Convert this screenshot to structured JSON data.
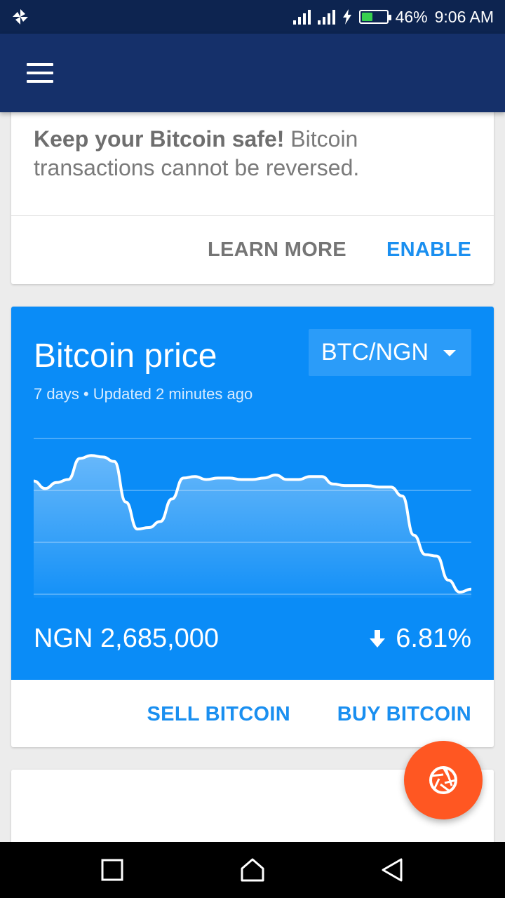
{
  "status_bar": {
    "battery_percent": "46%",
    "time": "9:06 AM",
    "battery_level": 0.46,
    "battery_color": "#37d04f"
  },
  "app_bar": {
    "menu_icon": "hamburger-menu-icon",
    "color": "#15306a"
  },
  "safety_card": {
    "headline": "Keep your Bitcoin safe!",
    "body": " Bitcoin transactions cannot be reversed.",
    "learn_more_label": "LEARN MORE",
    "enable_label": "ENABLE"
  },
  "price_card": {
    "title": "Bitcoin price",
    "pair_selected": "BTC/NGN",
    "subtitle": "7 days • Updated 2 minutes ago",
    "price": "NGN 2,685,000",
    "change": "6.81%",
    "change_direction": "down",
    "sell_label": "SELL BITCOIN",
    "buy_label": "BUY BITCOIN",
    "panel_color": "#0a8cf7",
    "chart_series": [
      0.74,
      0.69,
      0.73,
      0.75,
      0.89,
      0.91,
      0.9,
      0.87,
      0.6,
      0.42,
      0.43,
      0.47,
      0.62,
      0.76,
      0.77,
      0.75,
      0.76,
      0.76,
      0.75,
      0.75,
      0.76,
      0.78,
      0.75,
      0.75,
      0.77,
      0.77,
      0.72,
      0.71,
      0.71,
      0.71,
      0.7,
      0.7,
      0.64,
      0.38,
      0.25,
      0.24,
      0.08,
      0.0,
      0.02
    ]
  },
  "fab": {
    "icon": "camera-shutter-icon",
    "color": "#ff5722"
  },
  "nav_bar": {
    "icons": [
      "recent-apps-icon",
      "home-icon",
      "back-icon"
    ]
  }
}
